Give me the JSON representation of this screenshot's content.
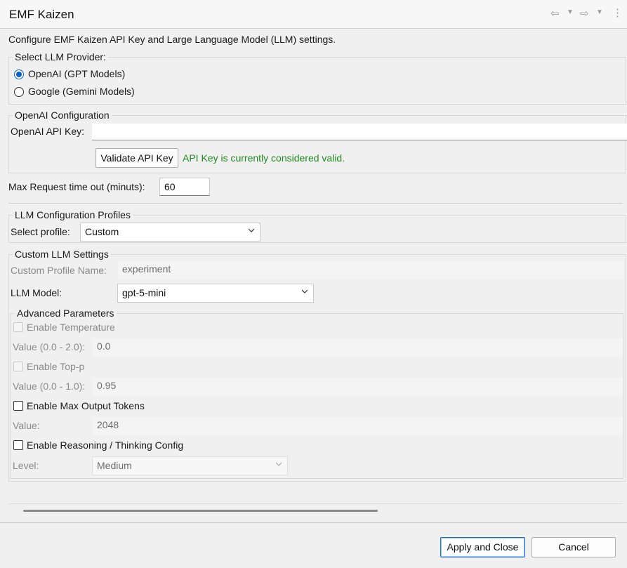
{
  "window": {
    "title": "EMF Kaizen",
    "nav_icons": [
      "back-arrow-icon",
      "dropdown-icon",
      "forward-arrow-icon",
      "dropdown-icon",
      "kebab-menu-icon"
    ]
  },
  "intro": "Configure EMF Kaizen API Key and Large Language Model (LLM) settings.",
  "provider": {
    "label": "Select LLM Provider:",
    "options": [
      {
        "label": "OpenAI (GPT Models)",
        "checked": true
      },
      {
        "label": "Google (Gemini Models)",
        "checked": false
      }
    ]
  },
  "openai": {
    "group_label": "OpenAI Configuration",
    "api_key_label": "OpenAI API Key:",
    "api_key_value": "",
    "validate_button": "Validate API Key",
    "validation_status": "API Key is currently considered valid."
  },
  "timeout": {
    "label": "Max Request time out (minuts):",
    "value": "60"
  },
  "profiles": {
    "group_label": "LLM Configuration Profiles",
    "select_label": "Select profile:",
    "selected": "Custom"
  },
  "custom": {
    "group_label": "Custom LLM Settings",
    "profile_name_label": "Custom Profile Name:",
    "profile_name_value": "experiment",
    "model_label": "LLM Model:",
    "model_value": "gpt-5-mini"
  },
  "advanced": {
    "group_label": "Advanced Parameters",
    "temperature": {
      "label": "Enable Temperature",
      "value_label": "Value (0.0 - 2.0):",
      "value": "0.0"
    },
    "top_p": {
      "label": "Enable Top-p",
      "value_label": "Value (0.0 - 1.0):",
      "value": "0.95"
    },
    "max_tokens": {
      "label": "Enable Max Output Tokens",
      "value_label": "Value:",
      "value": "2048"
    },
    "reasoning": {
      "label": "Enable Reasoning / Thinking Config",
      "value_label": "Level:",
      "value": "Medium"
    }
  },
  "footer": {
    "apply_button": "Apply and Close",
    "cancel_button": "Cancel"
  },
  "colors": {
    "accent": "#0a5fc7",
    "valid_status": "#1f8b1f"
  }
}
